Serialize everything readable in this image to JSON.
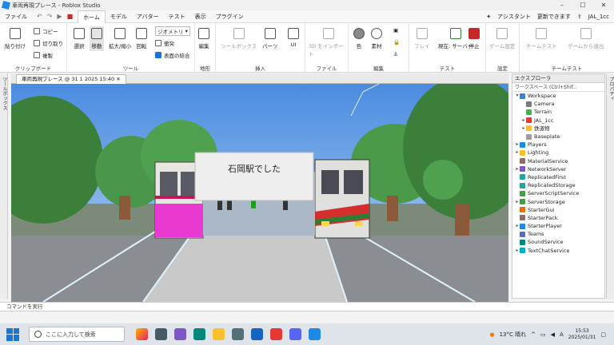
{
  "window": {
    "title": "車両再現プレース - Roblox Studio",
    "min": "–",
    "max": "☐",
    "close": "✕"
  },
  "menu": {
    "items": [
      "ファイル",
      "ホーム",
      "モデル",
      "アバター",
      "テスト",
      "表示",
      "プラグイン"
    ],
    "active": "ホーム",
    "assistant": "アシスタント",
    "update": "更新できます",
    "user": "JAL_1cc"
  },
  "ribbon": {
    "clipboard": {
      "label": "クリップボード",
      "paste": "貼り付け",
      "copy": "コピー",
      "cut": "切り取り",
      "duplicate": "複製"
    },
    "tools": {
      "label": "ツール",
      "select": "選択",
      "move": "移動",
      "scale": "拡大/縮小",
      "rotate": "回転",
      "mode": "ジオメトリ",
      "collisions": "衝突",
      "join": "表面の結合"
    },
    "terrain": {
      "label": "地形",
      "edit": "編集"
    },
    "insert": {
      "label": "挿入",
      "toolbox": "ツールボックス",
      "part": "パーツ",
      "ui": "UI"
    },
    "file": {
      "label": "ファイル",
      "import3d": "3D をインポート"
    },
    "edit": {
      "label": "編集",
      "color": "色",
      "material": "素材"
    },
    "test": {
      "label": "テスト",
      "play": "プレイ",
      "current": "現在: サーバー",
      "stop": "停止"
    },
    "settings": {
      "label": "設定",
      "game": "ゲーム設定"
    },
    "teamtest": {
      "label": "チームテスト",
      "team": "チームテスト",
      "exit": "ゲームから退出"
    }
  },
  "left_tab": "ツールボックス",
  "right_tab": "プロパティ",
  "doc_tab": "車両再現プレース @ 31 1 2025 15:40",
  "viewport": {
    "sign_text": "石岡駅でした"
  },
  "explorer": {
    "title": "エクスプローラ",
    "filter": "ワークスペース (Ctrl+Shif...",
    "tree": [
      {
        "label": "Workspace",
        "depth": 0,
        "arrow": "▾",
        "color": "#3f7fd6"
      },
      {
        "label": "Camera",
        "depth": 1,
        "arrow": "",
        "color": "#7a7a7a"
      },
      {
        "label": "Terrain",
        "depth": 1,
        "arrow": "",
        "color": "#4caf50"
      },
      {
        "label": "JAL_1cc",
        "depth": 1,
        "arrow": "▸",
        "color": "#e53935"
      },
      {
        "label": "鉄道物",
        "depth": 1,
        "arrow": "▸",
        "color": "#fbc02d"
      },
      {
        "label": "Baseplate",
        "depth": 1,
        "arrow": "",
        "color": "#9e9e9e"
      },
      {
        "label": "Players",
        "depth": 0,
        "arrow": "▸",
        "color": "#1e88e5"
      },
      {
        "label": "Lighting",
        "depth": 0,
        "arrow": "▸",
        "color": "#fbc02d"
      },
      {
        "label": "MaterialService",
        "depth": 0,
        "arrow": "",
        "color": "#8d6e63"
      },
      {
        "label": "NetworkServer",
        "depth": 0,
        "arrow": "▸",
        "color": "#7e57c2"
      },
      {
        "label": "ReplicatedFirst",
        "depth": 0,
        "arrow": "",
        "color": "#26a69a"
      },
      {
        "label": "ReplicatedStorage",
        "depth": 0,
        "arrow": "",
        "color": "#26a69a"
      },
      {
        "label": "ServerScriptService",
        "depth": 0,
        "arrow": "",
        "color": "#43a047"
      },
      {
        "label": "ServerStorage",
        "depth": 0,
        "arrow": "▸",
        "color": "#43a047"
      },
      {
        "label": "StarterGui",
        "depth": 0,
        "arrow": "",
        "color": "#ef6c00"
      },
      {
        "label": "StarterPack",
        "depth": 0,
        "arrow": "",
        "color": "#8d6e63"
      },
      {
        "label": "StarterPlayer",
        "depth": 0,
        "arrow": "▸",
        "color": "#1e88e5"
      },
      {
        "label": "Teams",
        "depth": 0,
        "arrow": "",
        "color": "#5c6bc0"
      },
      {
        "label": "SoundService",
        "depth": 0,
        "arrow": "",
        "color": "#00897b"
      },
      {
        "label": "TextChatService",
        "depth": 0,
        "arrow": "▸",
        "color": "#00acc1"
      }
    ]
  },
  "command_bar": "コマンドを実行",
  "taskbar": {
    "search": "ここに入力して検索",
    "weather": "13°C 晴れ",
    "ime": "A",
    "time": "15:53",
    "date": "2025/01/31"
  }
}
